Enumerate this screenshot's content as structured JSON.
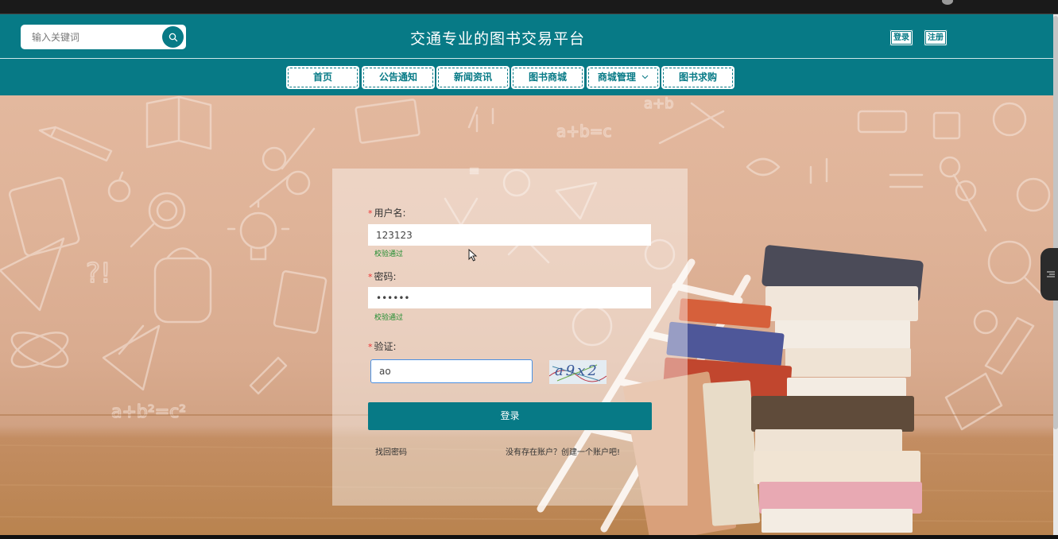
{
  "header": {
    "search": {
      "placeholder": "输入关键词",
      "icon": "search-icon"
    },
    "title": "交通专业的图书交易平台",
    "login_label": "登录",
    "register_label": "注册"
  },
  "nav": {
    "items": [
      {
        "label": "首页"
      },
      {
        "label": "公告通知"
      },
      {
        "label": "新闻资讯"
      },
      {
        "label": "图书商城"
      },
      {
        "label": "商城管理",
        "has_dropdown": true,
        "icon": "chevron-down-icon"
      },
      {
        "label": "图书求购"
      }
    ]
  },
  "login": {
    "username_label": "用户名:",
    "username_value": "123123",
    "username_status": "校验通过",
    "password_label": "密码:",
    "password_value": "••••••",
    "password_status": "校验通过",
    "captcha_label": "验证:",
    "captcha_value": "ao",
    "captcha_text": "a9x2",
    "submit_label": "登录",
    "forgot_label": "找回密码",
    "signup_prompt": "没有存在账户？创建一个账户吧!",
    "required_mark": "*"
  },
  "colors": {
    "primary": "#077a86",
    "success": "#1e8c2e",
    "required": "#ee3333"
  }
}
